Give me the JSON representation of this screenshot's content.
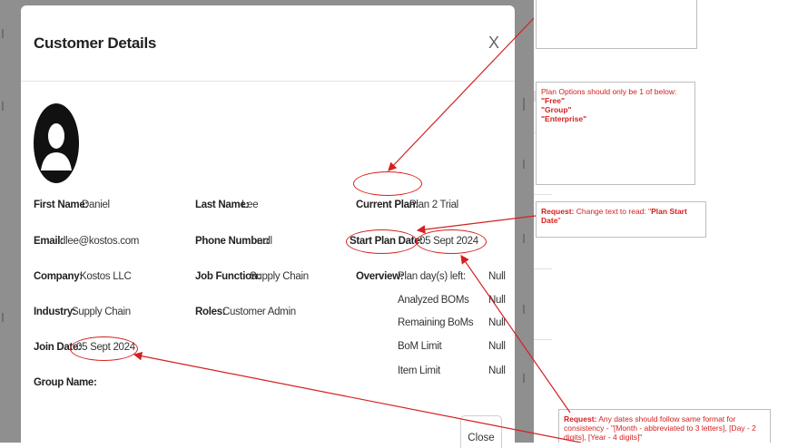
{
  "modal": {
    "title": "Customer Details",
    "close_x": "X",
    "close_button": "Close"
  },
  "fields": {
    "first_name": {
      "label": "First Name:",
      "value": "Daniel"
    },
    "email": {
      "label": "Email:",
      "value": "dlee@kostos.com"
    },
    "company": {
      "label": "Company:",
      "value": "Kostos LLC"
    },
    "industry": {
      "label": "Industry:",
      "value": "Supply Chain"
    },
    "join_date": {
      "label": "Join Date:",
      "value": "05 Sept 2024"
    },
    "group_name": {
      "label": "Group Name:",
      "value": ""
    },
    "last_name": {
      "label": "Last Name:",
      "value": "Lee"
    },
    "phone": {
      "label": "Phone Number:",
      "value": "null"
    },
    "job_function": {
      "label": "Job Function:",
      "value": "Supply Chain"
    },
    "roles": {
      "label": "Roles:",
      "value": "Customer Admin"
    },
    "current_plan": {
      "label": "Current Plan:",
      "value": "Plan 2 Trial"
    },
    "start_plan_date": {
      "label": "Start Plan Date:",
      "value": "05 Sept 2024"
    }
  },
  "overview": {
    "label": "Overview:",
    "rows": [
      {
        "name": "Plan day(s) left:",
        "value": "Null"
      },
      {
        "name": "Analyzed BOMs",
        "value": "Null"
      },
      {
        "name": "Remaining BoMs",
        "value": "Null"
      },
      {
        "name": "BoM Limit",
        "value": "Null"
      },
      {
        "name": "Item Limit",
        "value": "Null"
      }
    ]
  },
  "notes": {
    "plan_options": {
      "text": "Plan Options should only be 1 of below:",
      "options": [
        "\"Free\"",
        "\"Group\"",
        "\"Enterprise\""
      ]
    },
    "plan_start": {
      "bold": "Request:",
      "text": " Change text to read: \"",
      "quote": "Plan Start Date",
      "end": "\""
    },
    "dates": {
      "bold": "Request:",
      "text": " Any dates should follow same format for consistency - \"[Month - abbreviated to 3 letters], [Day - 2 digits], [Year - 4 digits]\""
    }
  },
  "colors": {
    "annotation_red": "#d42020",
    "backdrop": "#8f8f8f"
  }
}
